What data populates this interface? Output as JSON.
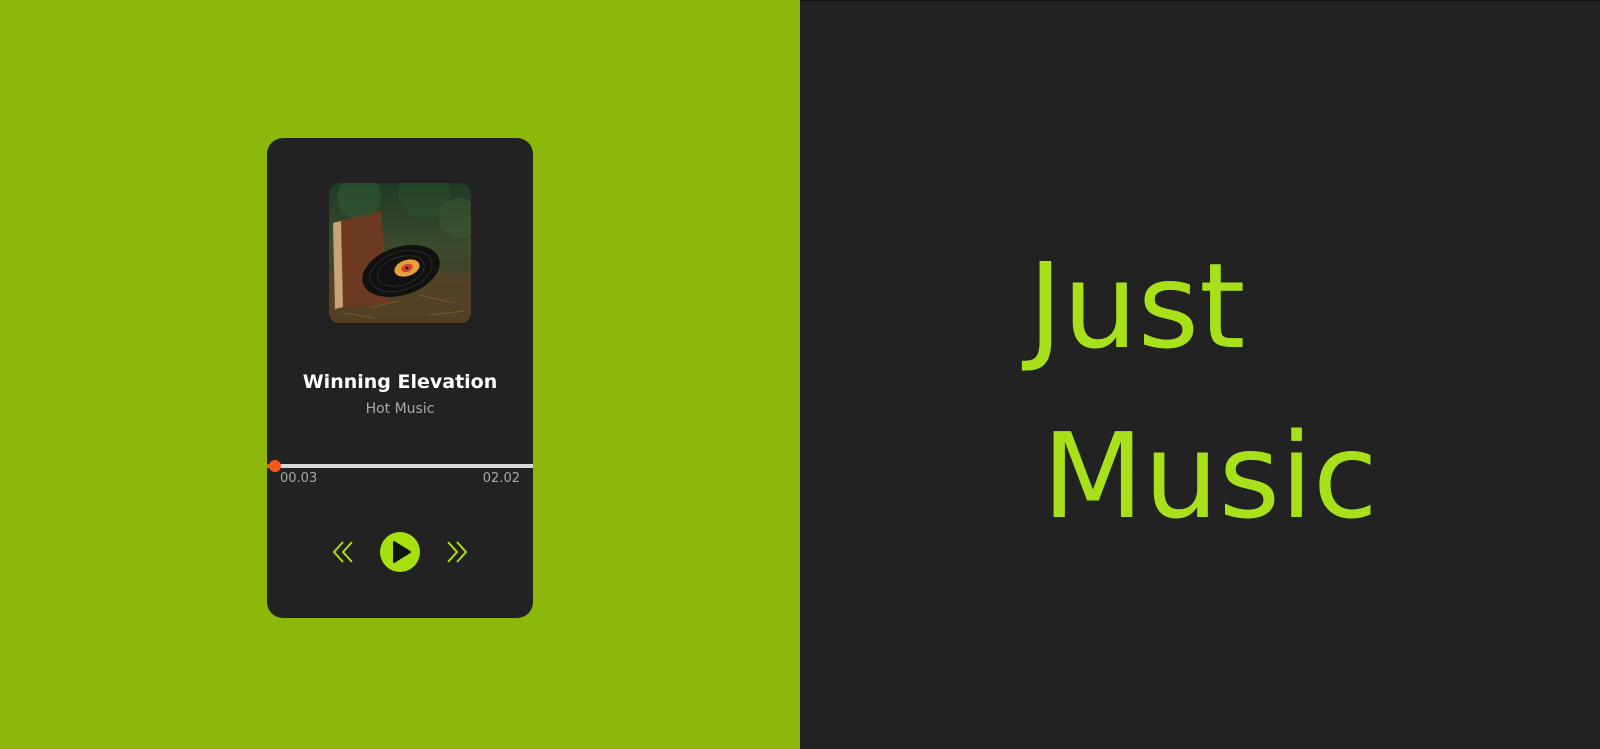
{
  "player": {
    "track_title": "Winning Elevation",
    "track_artist": "Hot Music",
    "time_current": "00.03",
    "time_total": "02.02",
    "progress_fraction": 0.03,
    "icons": {
      "album": "vinyl-record-album-art-icon",
      "prev": "double-chevron-left-icon",
      "play": "play-icon",
      "next": "double-chevron-right-icon"
    }
  },
  "hero": {
    "line1": "Just",
    "line2": "Music"
  },
  "colors": {
    "left_background": "#8bb80b",
    "right_background": "#222222",
    "accent": "#a8e11a",
    "progress_active": "#f25a1d"
  }
}
